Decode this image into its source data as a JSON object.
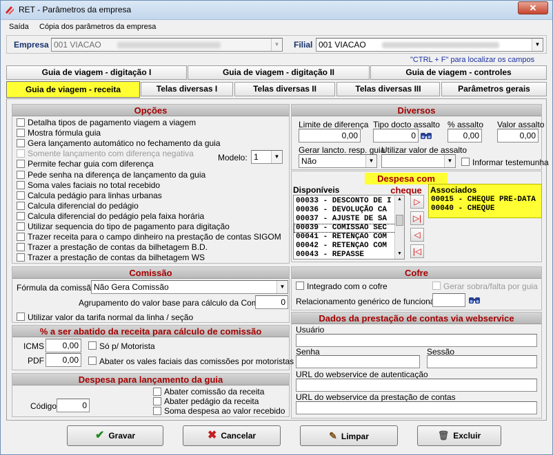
{
  "window": {
    "title": "RET - Parâmetros da empresa"
  },
  "menu": [
    "Saída",
    "Cópia dos parâmetros da empresa"
  ],
  "empresa": {
    "label": "Empresa",
    "value": "001 VIACAO"
  },
  "filial": {
    "label": "Filial",
    "value": "001 VIACAO"
  },
  "hint": "\"CTRL + F\" para localizar os campos",
  "tabs_row1": [
    "Guia de viagem - digitação I",
    "Guia de viagem - digitação II",
    "Guia de viagem - controles"
  ],
  "tabs_row2": [
    "Guia de viagem - receita",
    "Telas diversas I",
    "Telas diversas II",
    "Telas diversas III",
    "Parâmetros gerais"
  ],
  "opcoes": {
    "title": "Opções",
    "items": [
      "Detalha tipos de pagamento viagem a viagem",
      "Mostra fórmula guia",
      "Gera lançamento automático no fechamento da guia",
      "Somente lançamento com diferença negativa",
      "Permite fechar guia com diferença",
      "Pede senha na diferença de lançamento da guia",
      "Soma vales faciais no total recebido",
      "Calcula pedágio para linhas urbanas",
      "Calcula diferencial do pedágio",
      "Calcula diferencial do pedágio pela faixa horária",
      "Utilizar sequencia do tipo de pagamento para digitação",
      "Trazer receita para o campo dinheiro na prestação de contas SIGOM",
      "Trazer a prestação de contas da bilhetagem B.D.",
      "Trazer a prestação de contas da bilhetagem WS"
    ],
    "modelo_label": "Modelo:",
    "modelo_value": "1"
  },
  "diversos": {
    "title": "Diversos",
    "limite_label": "Limite de diferença",
    "limite_value": "0,00",
    "tipo_label": "Tipo docto assalto",
    "tipo_value": "0",
    "pct_label": "% assalto",
    "pct_value": "0,00",
    "valor_label": "Valor assalto",
    "valor_value": "0,00",
    "gerar_label": "Gerar lancto. resp. guia",
    "gerar_value": "Não",
    "utilizar_label": "Utilizar valor de assalto",
    "utilizar_value": "",
    "informar_label": "Informar testemunha"
  },
  "despesa_cheque": {
    "title": "Despesa com cheque",
    "disponiveis_label": "Disponíveis",
    "disponiveis": [
      "00033 - DESCONTO DE I",
      "00036 - DEVOLUÇÃO CA",
      "00037 - AJUSTE DE SA",
      "00039 - COMISSAO SEC",
      "00041 - RETENÇAO COM",
      "00042 - RETENÇAO COM",
      "00043 - REPASSE"
    ],
    "associados_label": "Associados",
    "associados": [
      "00015 - CHEQUE PRE-DATA",
      "00040 - CHEQUE"
    ],
    "arrows": [
      "▷",
      "▷|",
      "◁",
      "|◁"
    ]
  },
  "comissao": {
    "title": "Comissão",
    "formula_label": "Fórmula da comissão",
    "formula_value": "Não Gera Comissão",
    "agrup_label": "Agrupamento do valor base para cálculo da Comissão",
    "agrup_value": "0",
    "tarifa_label": "Utilizar valor da tarifa normal da linha / seção"
  },
  "cofre": {
    "title": "Cofre",
    "integrado_label": "Integrado com o cofre",
    "gerar_sobra_label": "Gerar sobra/falta por guia",
    "relac_label": "Relacionamento genérico de funcionários"
  },
  "abatido": {
    "title": "% a ser abatido da receita para cálculo de comissão",
    "icms_label": "ICMS",
    "icms_value": "0,00",
    "pdf_label": "PDF",
    "pdf_value": "0,00",
    "motorista_label": "Só p/ Motorista",
    "vales_label": "Abater os vales faciais das comissões por motoristas"
  },
  "despesa_guia": {
    "title": "Despesa para lançamento da guia",
    "codigo_label": "Código",
    "codigo_value": "0",
    "items": [
      "Abater comissão da receita",
      "Abater pedágio da receita",
      "Soma despesa ao valor recebido"
    ]
  },
  "webservice": {
    "title": "Dados da prestação de contas via webservice",
    "usuario_label": "Usuário",
    "senha_label": "Senha",
    "sessao_label": "Sessão",
    "url_auth_label": "URL do webservice de autenticação",
    "url_prest_label": "URL do webservice da prestação de contas"
  },
  "buttons": {
    "gravar": "Gravar",
    "cancelar": "Cancelar",
    "limpar": "Limpar",
    "excluir": "Excluir"
  },
  "colors": {
    "highlight": "#ffff33",
    "section_title": "#a40000",
    "window_bg": "#f0f0f0"
  }
}
